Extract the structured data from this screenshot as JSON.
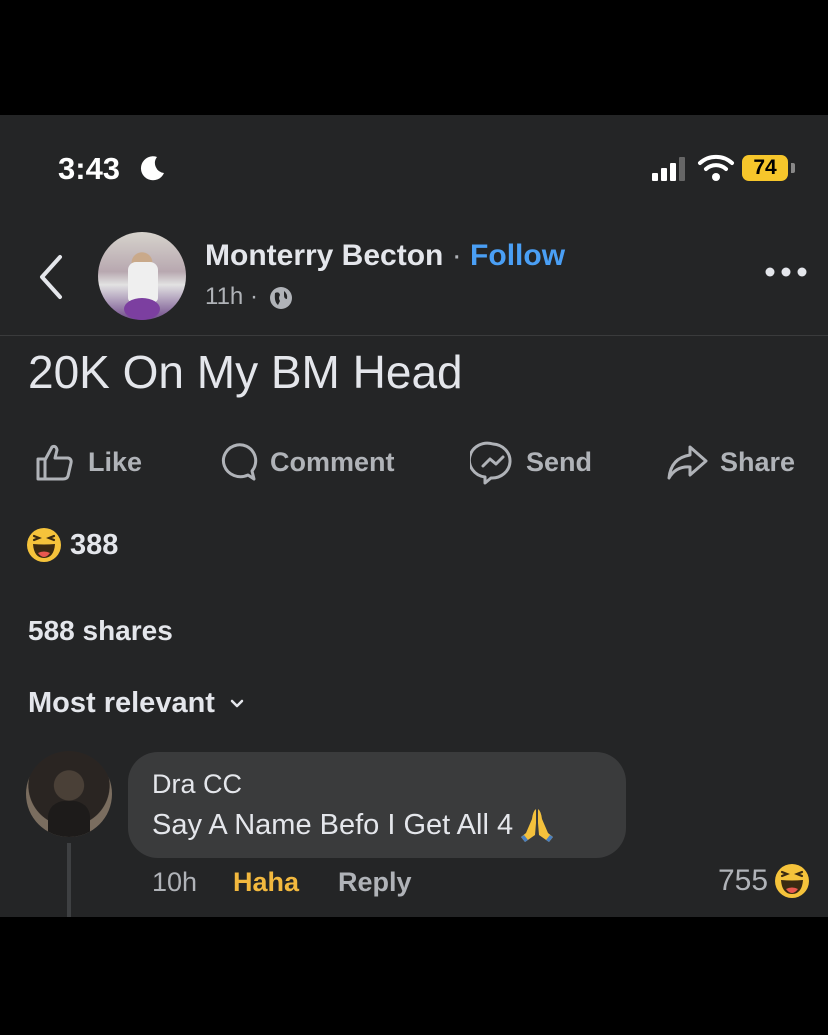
{
  "status_bar": {
    "time": "3:43",
    "battery": "74"
  },
  "post": {
    "author": "Monterry Becton",
    "separator": "·",
    "follow_label": "Follow",
    "time_ago": "11h",
    "meta_separator": "·",
    "text": "20K On My BM Head",
    "actions": {
      "like": "Like",
      "comment": "Comment",
      "send": "Send",
      "share": "Share"
    },
    "reaction_count": "388",
    "shares": "588 shares",
    "sort_label": "Most relevant"
  },
  "comment": {
    "author": "Dra CC",
    "text": "Say A Name Befo I Get All 4",
    "time_ago": "10h",
    "reaction_label": "Haha",
    "reply_label": "Reply",
    "reaction_count": "755"
  },
  "icons": {
    "back": "chevron-left-icon",
    "globe": "globe-icon",
    "more": "more-icon",
    "reaction": "haha-emoji-icon",
    "pray": "folded-hands-emoji"
  },
  "colors": {
    "background": "#242526",
    "follow": "#4a9ff5",
    "haha": "#f2b83e",
    "battery": "#f6c62b"
  }
}
